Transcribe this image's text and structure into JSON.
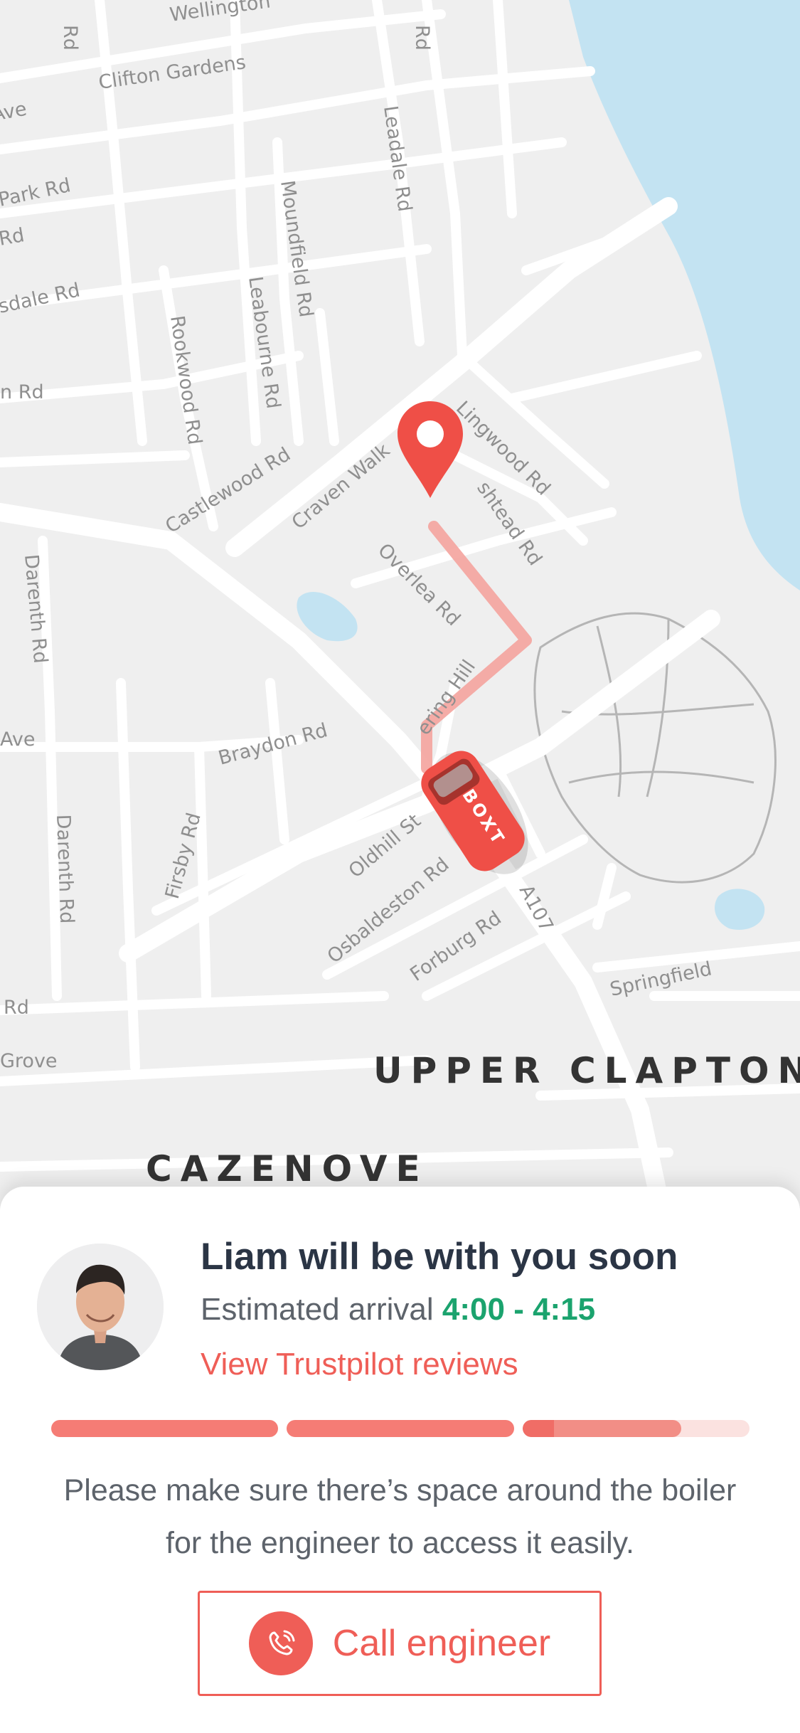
{
  "map": {
    "area_labels": [
      "UPPER CLAPTON",
      "CAZENOVE"
    ],
    "road_labels": [
      "Wellington",
      "Clifton Gardens",
      "Ave",
      "Park Rd",
      "Rd",
      "sdale Rd",
      "n Rd",
      "Rd",
      "Rd",
      "Leadale Rd",
      "Moundfield Rd",
      "Leabourne Rd",
      "Rookwood Rd",
      "Castlewood Rd",
      "Craven Walk",
      "Lingwood Rd",
      "shtead Rd",
      "Overlea Rd",
      "Darenth Rd",
      "Ave",
      "Braydon Rd",
      "ering Hill",
      "Oldhill St",
      "Osbaldeston Rd",
      "Firsby Rd",
      "Darenth Rd",
      "Forburg Rd",
      "A107",
      "Springfield",
      "Rd",
      "Grove"
    ],
    "van_label": "BOXT",
    "route_color": "#f4a39d",
    "pin_color": "#ef4f47",
    "water_color": "#c3e3f2"
  },
  "card": {
    "title": "Liam will be with you soon",
    "eta_prefix": "Estimated arrival",
    "eta_time": "4:00 - 4:15",
    "reviews_link": "View Trustpilot reviews",
    "progress": {
      "segments": 3,
      "completed": 2,
      "current_fraction": 0.7
    },
    "note": "Please make sure there’s space around the boiler for the engineer to access it easily.",
    "call_button": "Call engineer",
    "accent_color": "#ef5e57",
    "eta_color": "#1ba36e"
  }
}
